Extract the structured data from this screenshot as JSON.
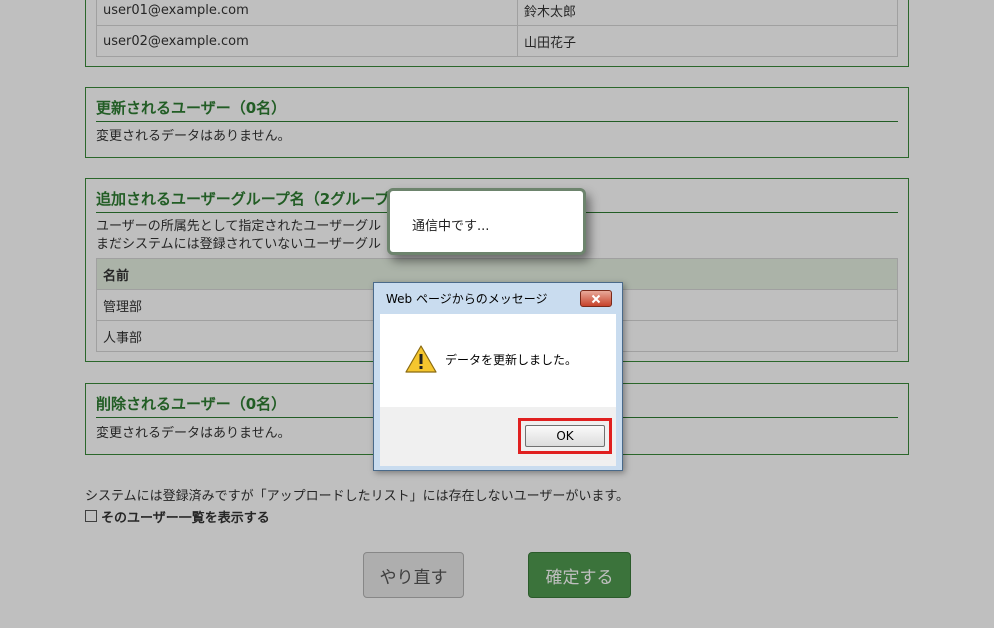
{
  "users_table": {
    "rows": [
      {
        "email": "user01@example.com",
        "name": "鈴木太郎"
      },
      {
        "email": "user02@example.com",
        "name": "山田花子"
      }
    ]
  },
  "updated_users": {
    "title": "更新されるユーザー（0名）",
    "message": "変更されるデータはありません。"
  },
  "added_groups": {
    "title": "追加されるユーザーグループ名（2グループ",
    "desc_line1": "ユーザーの所属先として指定されたユーザーグル",
    "desc_line2": "まだシステムには登録されていないユーザーグル",
    "header_name": "名前",
    "rows": [
      "管理部",
      "人事部"
    ]
  },
  "deleted_users": {
    "title": "削除されるユーザー（0名）",
    "message": "変更されるデータはありません。"
  },
  "notice": "システムには登録済みですが「アップロードしたリスト」には存在しないユーザーがいます。",
  "show_users_label": "そのユーザー一覧を表示する",
  "buttons": {
    "redo": "やり直す",
    "confirm": "確定する"
  },
  "loading": {
    "text": "通信中です..."
  },
  "dialog": {
    "title": "Web ページからのメッセージ",
    "message": "データを更新しました。",
    "ok": "OK"
  },
  "colors": {
    "accent": "#2e7d32",
    "confirm_button": "#4f9a4f",
    "highlight": "#e02020"
  },
  "icons": {
    "dialog_close": "close-icon",
    "dialog_warning": "warning-icon"
  }
}
